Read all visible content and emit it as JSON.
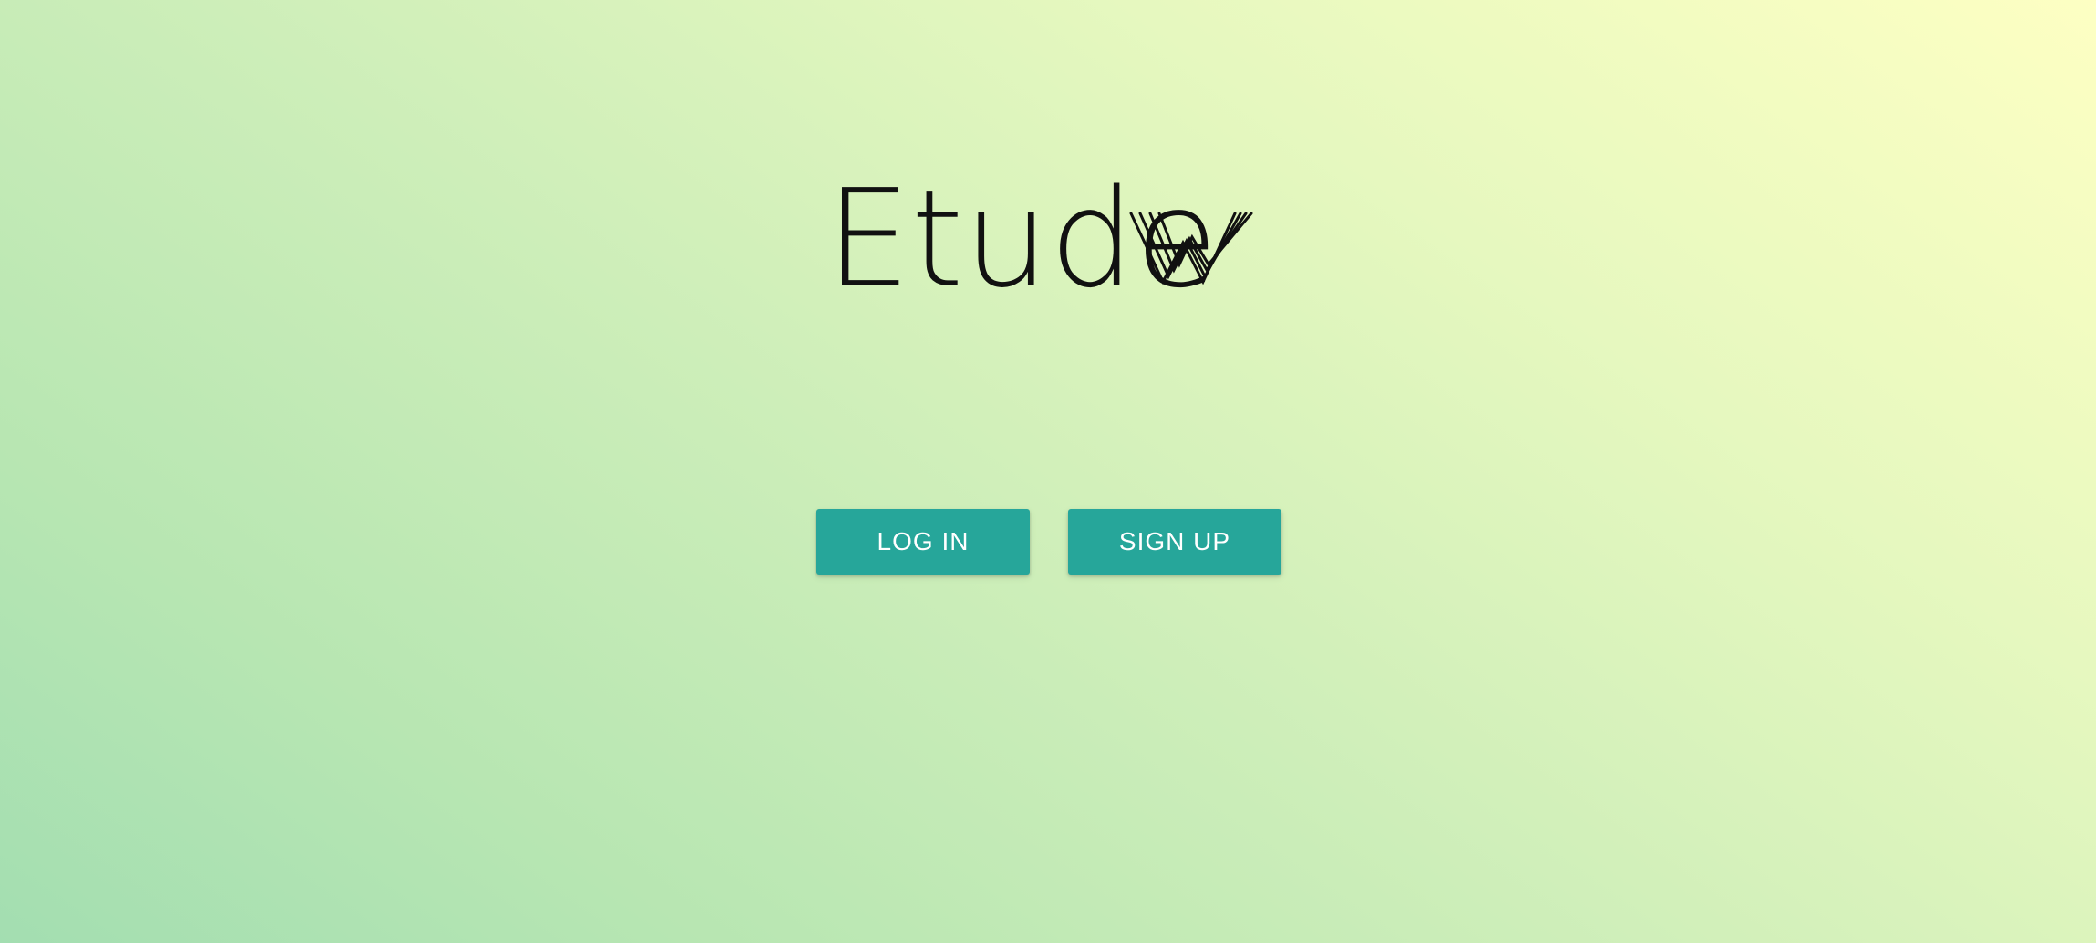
{
  "brand": {
    "name": "Etude",
    "logo_icon": "etude-w-lines-icon"
  },
  "actions": {
    "login_label": "LOG IN",
    "signup_label": "SIGN UP"
  },
  "colors": {
    "button_bg": "#26a69a",
    "button_text": "#ffffff",
    "gradient_start": "#fdffc3",
    "gradient_end": "#a3deb1",
    "logo": "#111111"
  }
}
